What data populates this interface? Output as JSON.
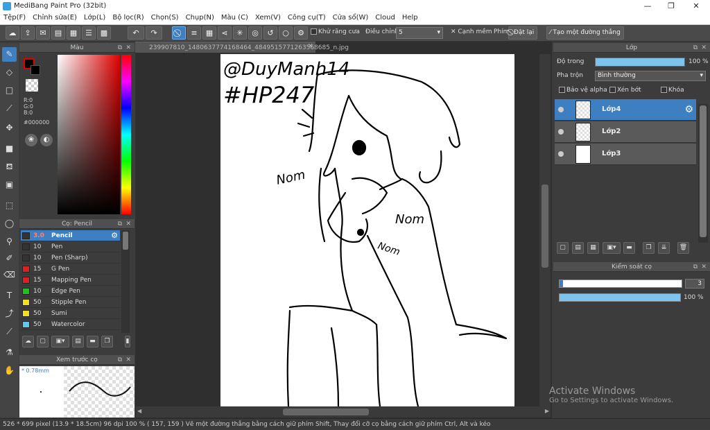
{
  "window": {
    "title": "MediBang Paint Pro (32bit)",
    "minimize": "—",
    "maximize": "❐",
    "close": "✕"
  },
  "menu": [
    "Tệp(F)",
    "Chỉnh sửa(E)",
    "Lớp(L)",
    "Bộ lọc(R)",
    "Chọn(S)",
    "Chụp(N)",
    "Màu (C)",
    "Xem(V)",
    "Công cụ(T)",
    "Cửa sổ(W)",
    "Cloud",
    "Help"
  ],
  "toolbar": {
    "antialias_label": "Khử răng cưa",
    "adjust_label": "Điều chỉnh",
    "adjust_value": "5",
    "soft_edge_label": "Cạnh mềm",
    "key_label": "Phím",
    "reset_label": "Đặt lại",
    "straight_line_label": "Tạo một đường thẳng"
  },
  "color_panel": {
    "title": "Màu",
    "r": "R:0",
    "g": "G:0",
    "b": "B:0",
    "hex": "#000000",
    "current_color": "#000000"
  },
  "brush_panel": {
    "title": "Cọ: Pencil",
    "brushes": [
      {
        "size": "3.0",
        "name": "Pencil",
        "color": "#333333"
      },
      {
        "size": "10",
        "name": "Pen",
        "color": "#333333"
      },
      {
        "size": "10",
        "name": "Pen (Sharp)",
        "color": "#333333"
      },
      {
        "size": "15",
        "name": "G Pen",
        "color": "#e02020"
      },
      {
        "size": "15",
        "name": "Mapping Pen",
        "color": "#e02020"
      },
      {
        "size": "10",
        "name": "Edge Pen",
        "color": "#20c020"
      },
      {
        "size": "50",
        "name": "Stipple Pen",
        "color": "#f0e020"
      },
      {
        "size": "50",
        "name": "Sumi",
        "color": "#f0e020"
      },
      {
        "size": "50",
        "name": "Watercolor",
        "color": "#60c8f0"
      }
    ]
  },
  "preview_panel": {
    "title": "Xem trước cọ",
    "size": "* 0.78mm"
  },
  "document": {
    "tab": "239907810_1480637774168464_4849515771263568685_n.jpg",
    "text_top1": "@DuyManh14",
    "text_top2": "#HP247",
    "text_nom1": "Nom",
    "text_nom2": "Nom",
    "text_nom3": "Nom"
  },
  "layer_panel": {
    "title": "Lớp",
    "opacity_label": "Độ trong",
    "opacity_value": "100 %",
    "opacity_level": 100,
    "blend_label": "Pha trộn",
    "blend_value": "Bình thường",
    "protect_alpha": "Bảo vệ alpha",
    "clip": "Xén bớt",
    "lock": "Khóa",
    "layers": [
      {
        "name": "Lớp4"
      },
      {
        "name": "Lớp2"
      },
      {
        "name": "Lớp3"
      }
    ]
  },
  "control_panel": {
    "title": "Kiểm soát cọ",
    "size_value": "3",
    "opacity_value": "100 %",
    "opacity_level": 100
  },
  "status": {
    "text": "526 * 699 pixel   (13.9 * 18.5cm)   96 dpi   100 %   ( 157, 159 )   Vẽ một đường thẳng bằng cách giữ phím Shift, Thay đổi cỡ cọ bằng cách giữ phím Ctrl, Alt và kéo"
  },
  "watermark": {
    "line1": "Activate Windows",
    "line2": "Go to Settings to activate Windows."
  }
}
